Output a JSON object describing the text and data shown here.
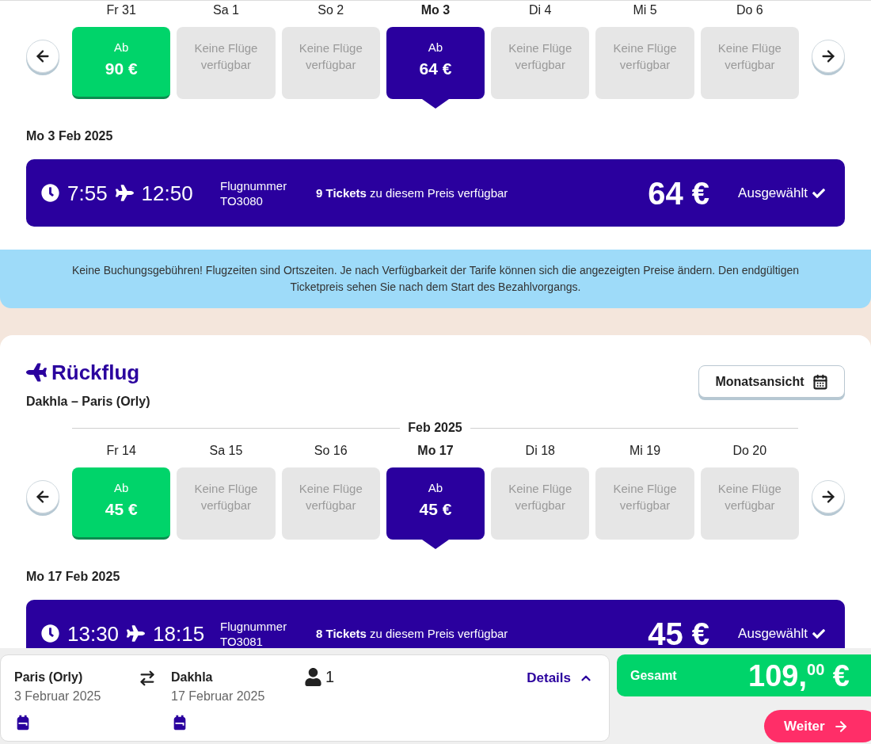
{
  "outbound": {
    "days": [
      {
        "label": "Fr 31",
        "kind": "price",
        "caption": "Ab",
        "price": "90 €",
        "selected": false
      },
      {
        "label": "Sa 1",
        "kind": "none",
        "caption": "Keine Flüge verfügbar",
        "selected": false
      },
      {
        "label": "So 2",
        "kind": "none",
        "caption": "Keine Flüge verfügbar",
        "selected": false
      },
      {
        "label": "Mo 3",
        "kind": "price",
        "caption": "Ab",
        "price": "64 €",
        "selected": true
      },
      {
        "label": "Di 4",
        "kind": "none",
        "caption": "Keine Flüge verfügbar",
        "selected": false
      },
      {
        "label": "Mi 5",
        "kind": "none",
        "caption": "Keine Flüge verfügbar",
        "selected": false
      },
      {
        "label": "Do 6",
        "kind": "none",
        "caption": "Keine Flüge verfügbar",
        "selected": false
      }
    ],
    "selected_date": "Mo 3 Feb 2025",
    "flight": {
      "departure": "7:55",
      "arrival": "12:50",
      "number_label": "Flugnummer",
      "number": "TO3080",
      "tickets": "**9 Tickets** zu diesem Preis verfügbar",
      "price": "64 €",
      "status": "Ausgewählt",
      "selected": true
    }
  },
  "notice": "Keine Buchungsgebühren! Flugzeiten sind Ortszeiten. Je nach Verfügbarkeit der Tarife können sich die angezeigten Preise ändern. Den endgültigen Ticketpreis sehen Sie nach dem Start des Bezahlvorgangs.",
  "return": {
    "title": "Rückflug",
    "route": "Dakhla – Paris (Orly)",
    "month_view_button": "Monatsansicht",
    "month": "Feb 2025",
    "days": [
      {
        "label": "Fr 14",
        "kind": "price",
        "caption": "Ab",
        "price": "45 €",
        "selected": false
      },
      {
        "label": "Sa 15",
        "kind": "none",
        "caption": "Keine Flüge verfügbar",
        "selected": false
      },
      {
        "label": "So 16",
        "kind": "none",
        "caption": "Keine Flüge verfügbar",
        "selected": false
      },
      {
        "label": "Mo 17",
        "kind": "price",
        "caption": "Ab",
        "price": "45 €",
        "selected": true
      },
      {
        "label": "Di 18",
        "kind": "none",
        "caption": "Keine Flüge verfügbar",
        "selected": false
      },
      {
        "label": "Mi 19",
        "kind": "none",
        "caption": "Keine Flüge verfügbar",
        "selected": false
      },
      {
        "label": "Do 20",
        "kind": "none",
        "caption": "Keine Flüge verfügbar",
        "selected": false
      }
    ],
    "selected_date": "Mo 17 Feb 2025",
    "flight": {
      "departure": "13:30",
      "arrival": "18:15",
      "number_label": "Flugnummer",
      "number": "TO3081",
      "tickets": "**8 Tickets** zu diesem Preis verfügbar",
      "price": "45 €",
      "status": "Ausgewählt",
      "selected": true
    }
  },
  "footer": {
    "legs": [
      {
        "city": "Paris (Orly)",
        "date": "3 Februar 2025"
      },
      {
        "city": "Dakhla",
        "date": "17 Februar 2025"
      }
    ],
    "passengers": "1",
    "details": {
      "label": "Details",
      "expanded": false
    },
    "total_label": "Gesamt",
    "total": "109,$^{00}$ €",
    "next_button": "Weiter"
  }
}
